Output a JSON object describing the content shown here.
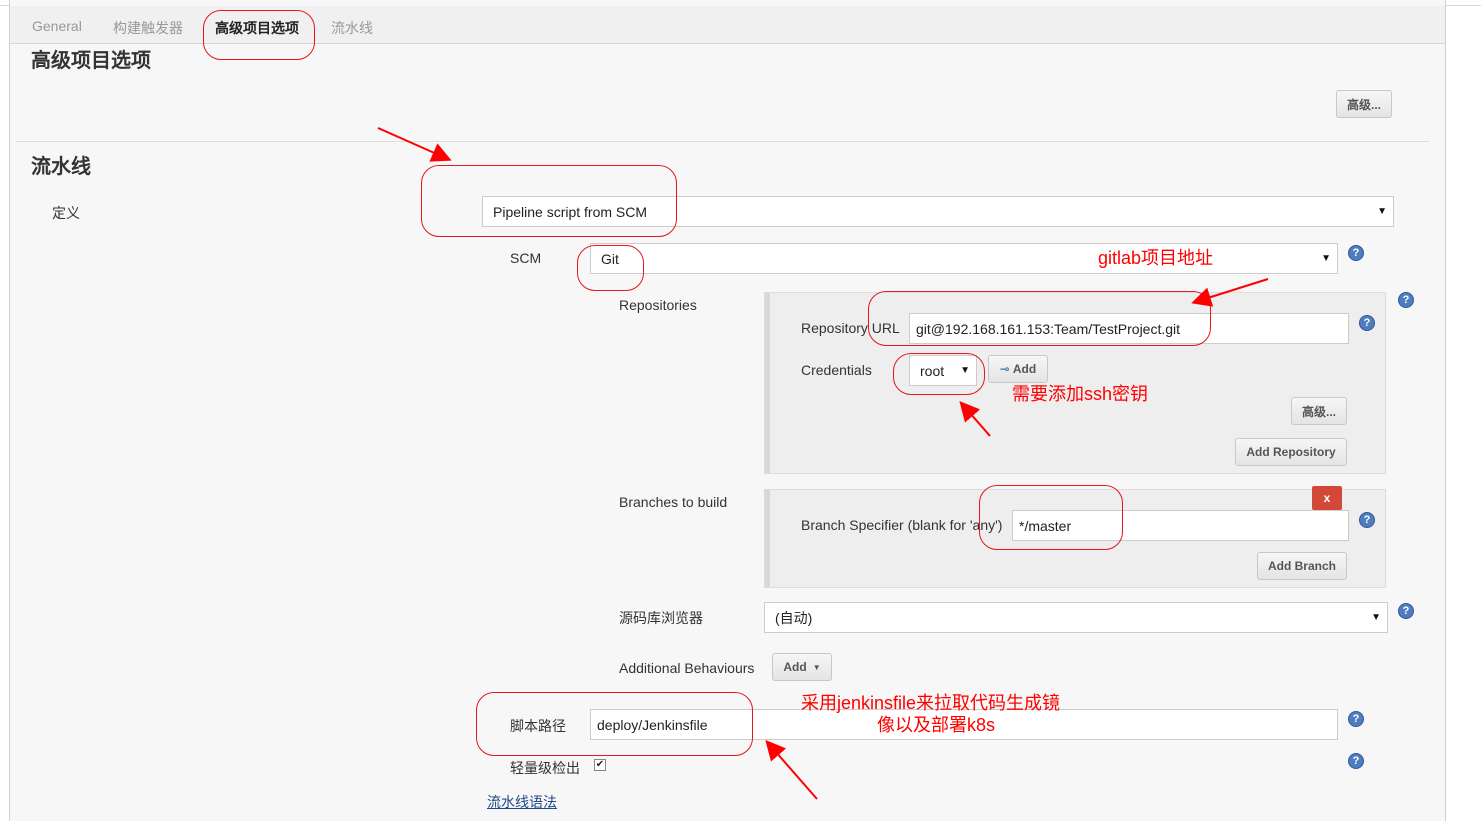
{
  "tabs": [
    {
      "label": "General"
    },
    {
      "label": "构建触发器"
    },
    {
      "label": "高级项目选项"
    },
    {
      "label": "流水线"
    }
  ],
  "advanced_section": {
    "title": "高级项目选项",
    "advanced_button": "高级..."
  },
  "pipeline_section": {
    "title": "流水线",
    "definition_label": "定义",
    "definition_value": "Pipeline script from SCM",
    "scm_label": "SCM",
    "scm_value": "Git",
    "repositories_label": "Repositories",
    "repo_url_label": "Repository URL",
    "repo_url_value": "git@192.168.161.153:Team/TestProject.git",
    "credentials_label": "Credentials",
    "credentials_value": "root",
    "add_credentials_button": "Add",
    "repo_advanced_button": "高级...",
    "add_repository_button": "Add Repository",
    "branches_label": "Branches to build",
    "branch_specifier_label": "Branch Specifier (blank for 'any')",
    "branch_specifier_value": "*/master",
    "delete_branch_button": "x",
    "add_branch_button": "Add Branch",
    "browser_label": "源码库浏览器",
    "browser_value": "(自动)",
    "additional_behaviours_label": "Additional Behaviours",
    "add_behaviour_button": "Add",
    "script_path_label": "脚本路径",
    "script_path_value": "deploy/Jenkinsfile",
    "lightweight_label": "轻量级检出",
    "lightweight_checked": true,
    "pipeline_syntax_link": "流水线语法"
  },
  "annotations": {
    "gitlab": "gitlab项目地址",
    "ssh": "需要添加ssh密钥",
    "jenkinsfile_line1": "采用jenkinsfile来拉取代码生成镜",
    "jenkinsfile_line2": "像以及部署k8s",
    "color": "#ff0000"
  },
  "help_icon": "?",
  "checkmark": "✔"
}
